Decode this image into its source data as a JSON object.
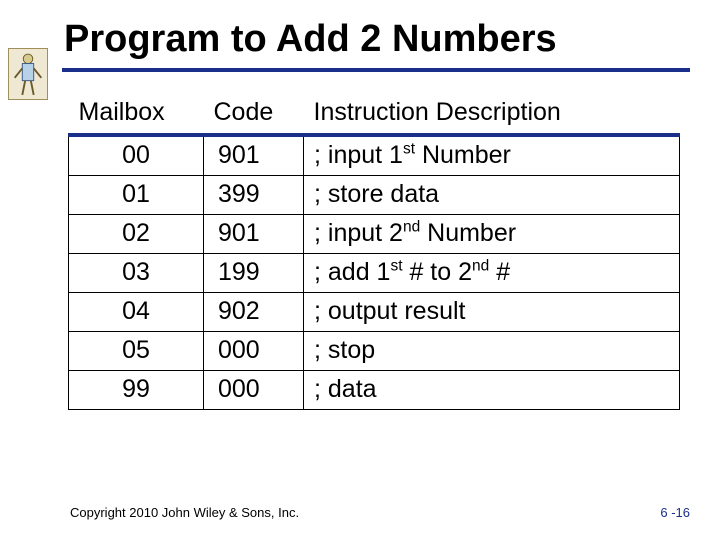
{
  "title": "Program to Add 2 Numbers",
  "table": {
    "headers": {
      "mailbox": "Mailbox",
      "code": "Code",
      "desc": "Instruction Description"
    },
    "rows": [
      {
        "mailbox": "00",
        "code": "901",
        "desc": "; input 1<sup>st</sup> Number"
      },
      {
        "mailbox": "01",
        "code": "399",
        "desc": "; store data"
      },
      {
        "mailbox": "02",
        "code": "901",
        "desc": "; input 2<sup>nd</sup> Number"
      },
      {
        "mailbox": "03",
        "code": "199",
        "desc": "; add 1<sup>st</sup> # to 2<sup>nd</sup> #"
      },
      {
        "mailbox": "04",
        "code": "902",
        "desc": "; output result"
      },
      {
        "mailbox": "05",
        "code": "000",
        "desc": "; stop"
      },
      {
        "mailbox": "99",
        "code": "000",
        "desc": "; data"
      }
    ]
  },
  "footer": {
    "copyright": "Copyright 2010 John Wiley & Sons, Inc.",
    "pagenum": "6 -16"
  }
}
